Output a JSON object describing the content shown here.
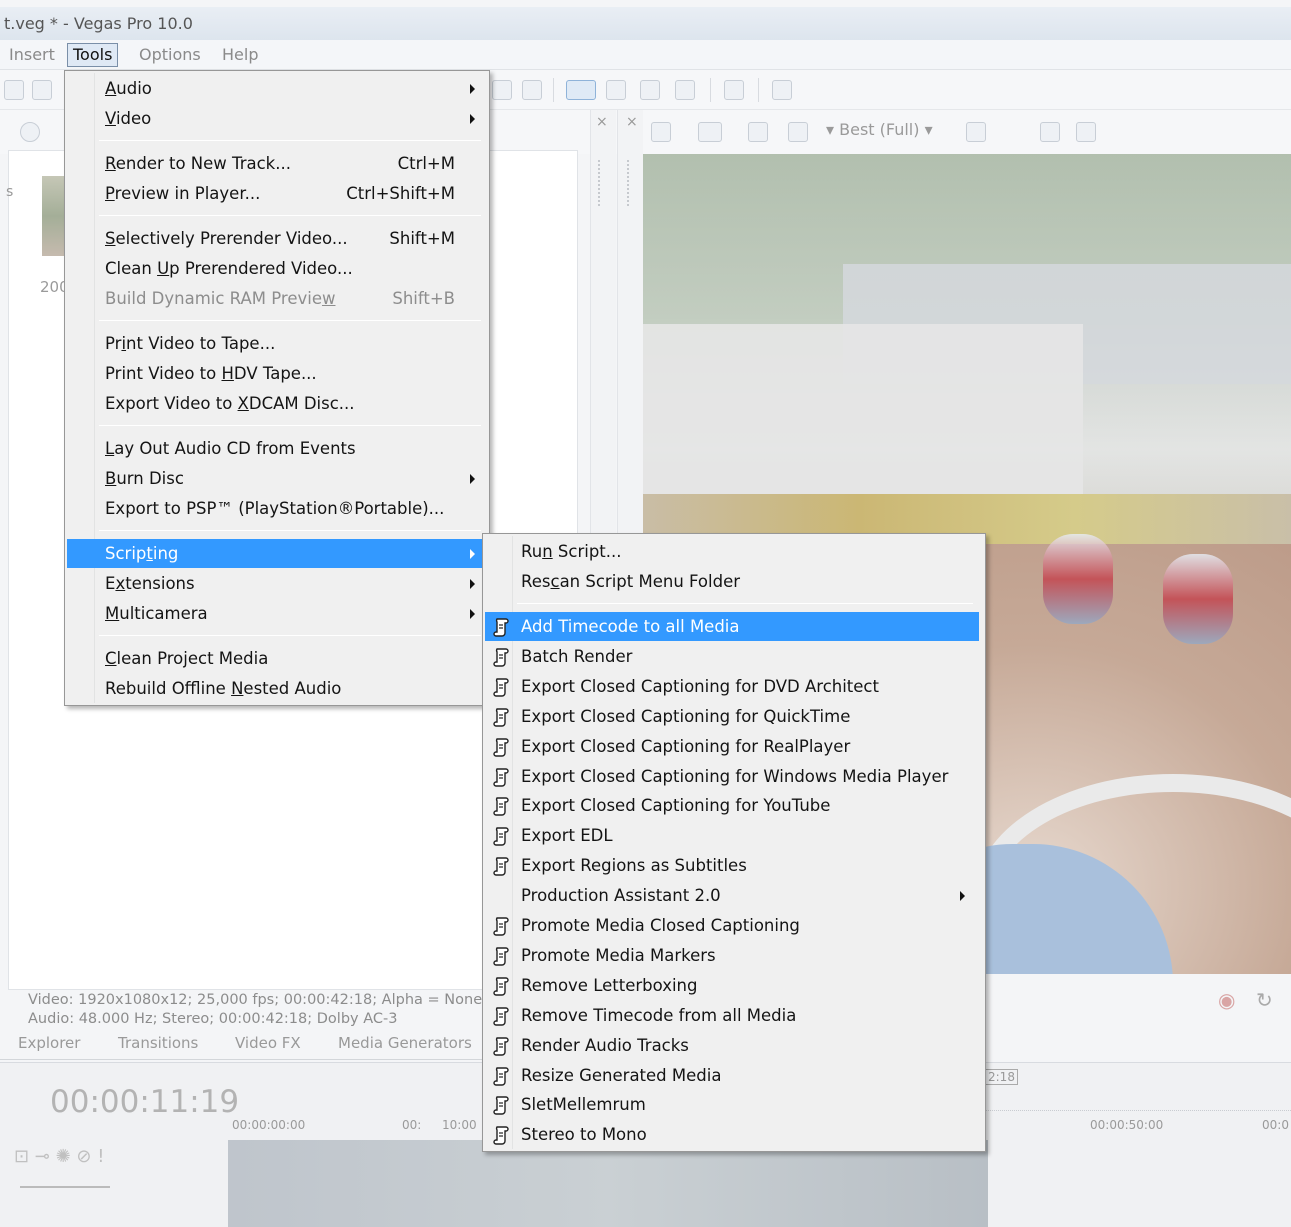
{
  "window": {
    "title": "t.veg * - Vegas Pro 10.0"
  },
  "menubar": {
    "items": [
      "Insert",
      "Tools",
      "Options",
      "Help"
    ],
    "active": "Tools"
  },
  "preview_toolbar": {
    "quality": "Best (Full)"
  },
  "left_pane": {
    "side_label": "s",
    "thumb_label": "200",
    "video_info": "Video: 1920x1080x12; 25,000 fps; 00:00:42:18; Alpha = None",
    "audio_info": "Audio: 48.000 Hz; Stereo; 00:00:42:18; Dolby AC-3"
  },
  "window_tabs": [
    "Explorer",
    "Transitions",
    "Video FX",
    "Media Generators"
  ],
  "timeline": {
    "time": "00:00:11:19",
    "ruler": [
      "00:00:00:00",
      "00:",
      "10:00",
      "00:00:50:00",
      "00:0"
    ],
    "end_marker": "2:18"
  },
  "tools_menu": {
    "groups": [
      [
        {
          "label": "Audio",
          "mn": "A",
          "rest": "udio",
          "submenu": true
        },
        {
          "label": "Video",
          "mn": "V",
          "rest": "ideo",
          "submenu": true
        }
      ],
      [
        {
          "pre": "",
          "mn": "R",
          "rest": "ender to New Track...",
          "shortcut": "Ctrl+M"
        },
        {
          "pre": "",
          "mn": "P",
          "rest": "review in Player...",
          "shortcut": "Ctrl+Shift+M"
        }
      ],
      [
        {
          "pre": "",
          "mn": "S",
          "rest": "electively Prerender Video...",
          "shortcut": "Shift+M"
        },
        {
          "pre": "Clean ",
          "mn": "U",
          "rest": "p Prerendered Video..."
        },
        {
          "pre": "Build Dynamic RAM Previe",
          "mn": "w",
          "rest": "",
          "shortcut": "Shift+B",
          "disabled": true
        }
      ],
      [
        {
          "pre": "Pr",
          "mn": "i",
          "rest": "nt Video to Tape..."
        },
        {
          "pre": "Print Video to ",
          "mn": "H",
          "rest": "DV Tape..."
        },
        {
          "pre": "Export Video to ",
          "mn": "X",
          "rest": "DCAM Disc..."
        }
      ],
      [
        {
          "pre": "",
          "mn": "L",
          "rest": "ay Out Audio CD from Events"
        },
        {
          "pre": "",
          "mn": "B",
          "rest": "urn Disc",
          "submenu": true
        },
        {
          "pre": "Export to PSP",
          "mn": "",
          "rest": "™ (PlayStation®Portable)..."
        }
      ],
      [
        {
          "pre": "Scrip",
          "mn": "t",
          "rest": "ing",
          "submenu": true,
          "highlighted": true
        },
        {
          "pre": "E",
          "mn": "x",
          "rest": "tensions",
          "submenu": true
        },
        {
          "pre": "",
          "mn": "M",
          "rest": "ulticamera",
          "submenu": true
        }
      ],
      [
        {
          "pre": "",
          "mn": "C",
          "rest": "lean Project Media"
        },
        {
          "pre": "Rebuild Offline ",
          "mn": "N",
          "rest": "ested Audio"
        }
      ]
    ]
  },
  "scripting_menu": {
    "top": [
      {
        "pre": "Ru",
        "mn": "n",
        "rest": " Script..."
      },
      {
        "pre": "Res",
        "mn": "c",
        "rest": "an Script Menu Folder"
      }
    ],
    "scripts": [
      {
        "label": "Add Timecode to all Media",
        "icon": "script-icon",
        "highlighted": true
      },
      {
        "label": "Batch Render",
        "icon": "script-icon"
      },
      {
        "label": "Export Closed Captioning for DVD Architect",
        "icon": "script-icon"
      },
      {
        "label": "Export Closed Captioning for QuickTime",
        "icon": "script-icon"
      },
      {
        "label": "Export Closed Captioning for RealPlayer",
        "icon": "script-icon"
      },
      {
        "label": "Export Closed Captioning for Windows Media Player",
        "icon": "script-icon"
      },
      {
        "label": "Export Closed Captioning for YouTube",
        "icon": "script-icon"
      },
      {
        "label": "Export EDL",
        "icon": "script-icon"
      },
      {
        "label": "Export Regions as Subtitles",
        "icon": "script-icon"
      },
      {
        "label": "Production Assistant 2.0",
        "icon": "",
        "submenu": true
      },
      {
        "label": "Promote Media Closed Captioning",
        "icon": "script-icon"
      },
      {
        "label": "Promote Media Markers",
        "icon": "script-icon"
      },
      {
        "label": "Remove Letterboxing",
        "icon": "script-icon"
      },
      {
        "label": "Remove Timecode from all Media",
        "icon": "script-icon"
      },
      {
        "label": "Render Audio Tracks",
        "icon": "script-icon"
      },
      {
        "label": "Resize Generated Media",
        "icon": "script-icon"
      },
      {
        "label": "SletMellemrum",
        "icon": "script-icon"
      },
      {
        "label": "Stereo to Mono",
        "icon": "script-icon"
      }
    ]
  },
  "colors": {
    "menu_highlight": "#3399ff",
    "menu_bg": "#f0f0f0"
  }
}
